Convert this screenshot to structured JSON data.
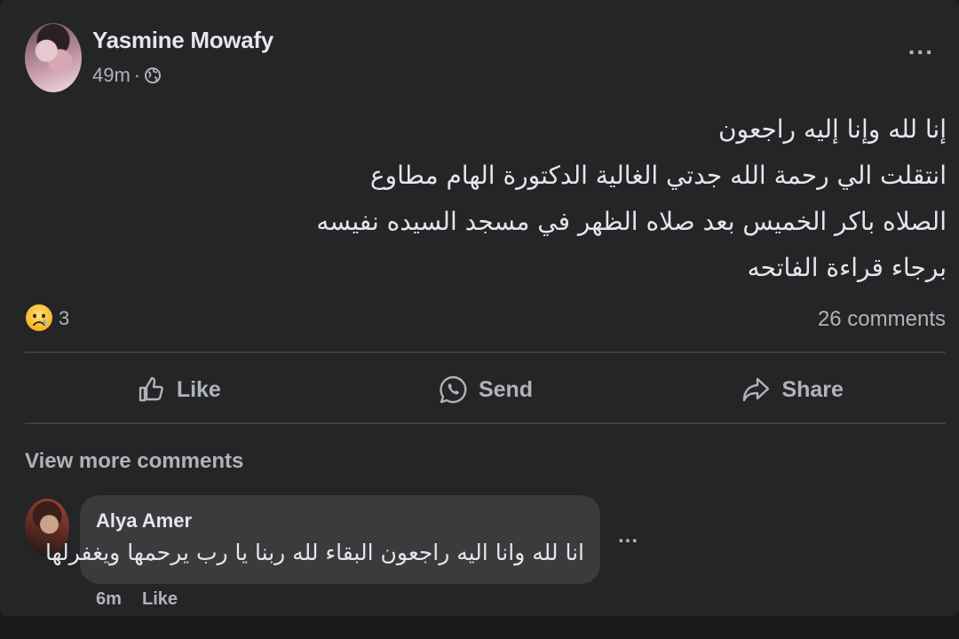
{
  "post": {
    "author": "Yasmine Mowafy",
    "time": "49m",
    "separator": "·",
    "privacy_icon": "globe-icon",
    "more_options": "...",
    "lines": [
      "إنا لله وإنا إليه راجعون",
      "انتقلت الي رحمة الله جدتي الغالية الدكتورة الهام مطاوع",
      "الصلاه باكر الخميس بعد صلاه الظهر في مسجد السيده نفيسه",
      "برجاء قراءة الفاتحه"
    ]
  },
  "reactions": {
    "icon": "sad-face-icon",
    "count": "3",
    "comments": "26 comments"
  },
  "actions": {
    "like": "Like",
    "send": "Send",
    "share": "Share"
  },
  "comments_section": {
    "view_more": "View more comments",
    "comment": {
      "author": "Alya Amer",
      "text": "انا لله وانا اليه راجعون البقاء لله ربنا يا رب يرحمها ويغفرلها",
      "more_options": "...",
      "time": "6m",
      "like": "Like"
    }
  },
  "colors": {
    "card_bg": "#242526",
    "page_bg": "#18191a",
    "primary_text": "#e4e6eb",
    "secondary_text": "#b0b3b8",
    "bubble_bg": "#3a3b3c",
    "divider": "#3e4042"
  }
}
